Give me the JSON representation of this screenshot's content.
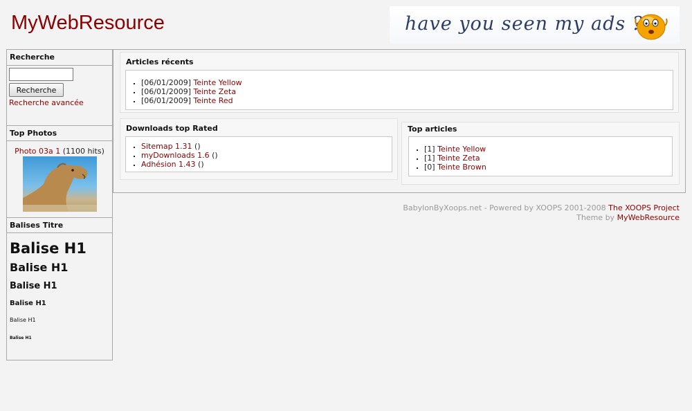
{
  "site": {
    "title": "MyWebResource"
  },
  "ad": {
    "text": "have you seen my ads ?"
  },
  "sidebar": {
    "search": {
      "title": "Recherche",
      "input_value": "",
      "button_label": "Recherche",
      "advanced_link": "Recherche avancée"
    },
    "top_photos": {
      "title": "Top Photos",
      "photo_link": "Photo 03a 1",
      "hits": "(1100 hits)"
    },
    "headings": {
      "title": "Balises Titre",
      "h1": "Balise H1",
      "h2": "Balise H1",
      "h3": "Balise H1",
      "h4": "Balise H1",
      "h5": "Balise H1",
      "h6": "Balise H1"
    }
  },
  "main": {
    "recent_articles": {
      "title": "Articles récents",
      "items": [
        {
          "date": "[06/01/2009]",
          "link": "Teinte Yellow"
        },
        {
          "date": "[06/01/2009]",
          "link": "Teinte Zeta"
        },
        {
          "date": "[06/01/2009]",
          "link": "Teinte Red"
        }
      ]
    },
    "downloads": {
      "title": "Downloads top Rated",
      "items": [
        {
          "link": "Sitemap 1.31",
          "suffix": " ()"
        },
        {
          "link": "myDownloads 1.6",
          "suffix": " ()"
        },
        {
          "link": "Adhésion 1.43",
          "suffix": " ()"
        }
      ]
    },
    "top_articles": {
      "title": "Top articles",
      "items": [
        {
          "count": "[1]",
          "link": "Teinte Yellow"
        },
        {
          "count": "[1]",
          "link": "Teinte Zeta"
        },
        {
          "count": "[0]",
          "link": "Teinte Brown"
        }
      ]
    }
  },
  "footer": {
    "powered_text": "BabylonByXoops.net - Powered by XOOPS 2001-2008 ",
    "xoops_link": "The XOOPS Project",
    "theme_text": "Theme by ",
    "theme_link": "MyWebResource"
  },
  "colors": {
    "link": "#8b0000",
    "background": "#f3f3f3",
    "border": "#a8a8a8"
  }
}
